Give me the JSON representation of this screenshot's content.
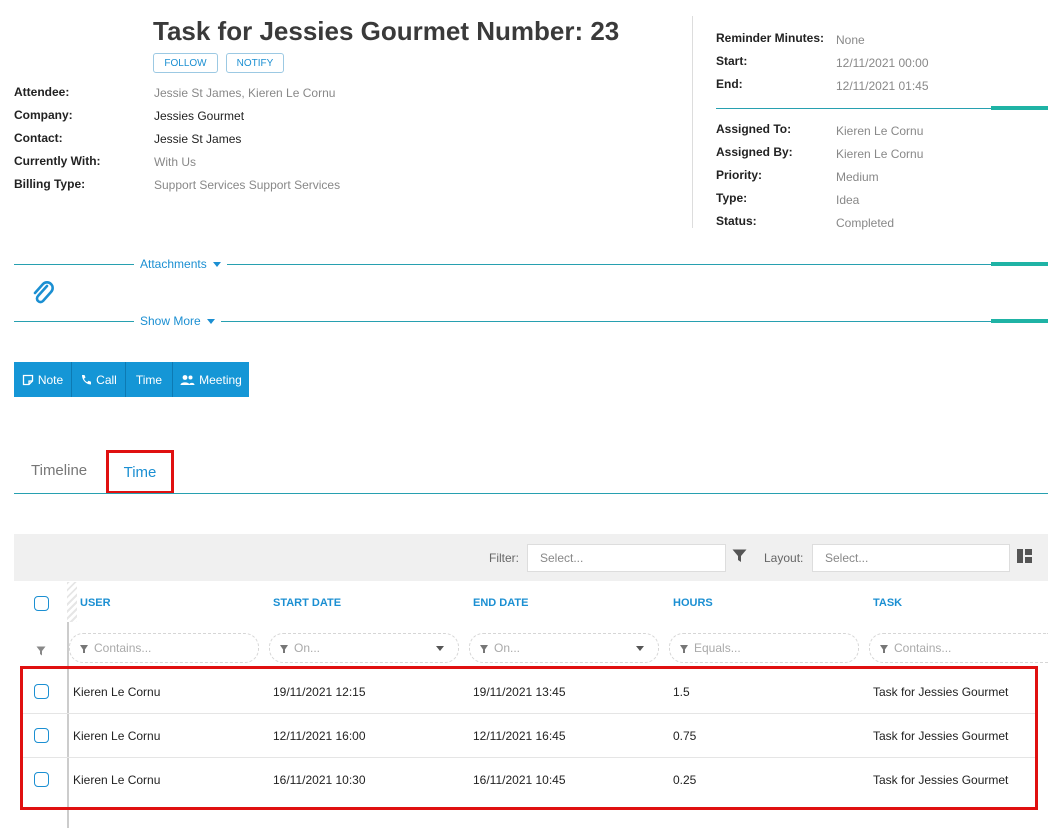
{
  "header": {
    "title": "Task for Jessies Gourmet Number: 23",
    "follow_label": "FOLLOW",
    "notify_label": "NOTIFY"
  },
  "left_fields": [
    {
      "label": "Attendee:",
      "value": "Jessie St James, Kieren Le Cornu"
    },
    {
      "label": "Company:",
      "value": "Jessies Gourmet"
    },
    {
      "label": "Contact:",
      "value": "Jessie St James"
    },
    {
      "label": "Currently With:",
      "value": "With Us"
    },
    {
      "label": "Billing Type:",
      "value": "Support Services Support Services"
    }
  ],
  "right_fields_top": [
    {
      "label": "Reminder Minutes:",
      "value": "None"
    },
    {
      "label": "Start:",
      "value": "12/11/2021 00:00"
    },
    {
      "label": "End:",
      "value": "12/11/2021 01:45"
    }
  ],
  "right_fields_bottom": [
    {
      "label": "Assigned To:",
      "value": "Kieren Le Cornu"
    },
    {
      "label": "Assigned By:",
      "value": "Kieren Le Cornu"
    },
    {
      "label": "Priority:",
      "value": "Medium"
    },
    {
      "label": "Type:",
      "value": "Idea"
    },
    {
      "label": "Status:",
      "value": "Completed"
    }
  ],
  "sections": {
    "attachments": "Attachments",
    "show_more": "Show More"
  },
  "actions": {
    "note": "Note",
    "call": "Call",
    "time": "Time",
    "meeting": "Meeting"
  },
  "tabs": {
    "timeline": "Timeline",
    "time": "Time"
  },
  "grid": {
    "filter_label": "Filter:",
    "filter_placeholder": "Select...",
    "layout_label": "Layout:",
    "layout_placeholder": "Select...",
    "columns": [
      "USER",
      "START DATE",
      "END DATE",
      "HOURS",
      "TASK"
    ],
    "filters": [
      "Contains...",
      "On...",
      "On...",
      "Equals...",
      "Contains..."
    ],
    "rows": [
      [
        "Kieren Le Cornu",
        "19/11/2021 12:15",
        "19/11/2021 13:45",
        "1.5",
        "Task for Jessies Gourmet"
      ],
      [
        "Kieren Le Cornu",
        "12/11/2021 16:00",
        "12/11/2021 16:45",
        "0.75",
        "Task for Jessies Gourmet"
      ],
      [
        "Kieren Le Cornu",
        "16/11/2021 10:30",
        "16/11/2021 10:45",
        "0.25",
        "Task for Jessies Gourmet"
      ]
    ]
  },
  "colors": {
    "accent": "#1b8fd2",
    "button_bg": "#1596d6",
    "teal_rule": "#1fb3a5",
    "highlight": "#e01010"
  }
}
